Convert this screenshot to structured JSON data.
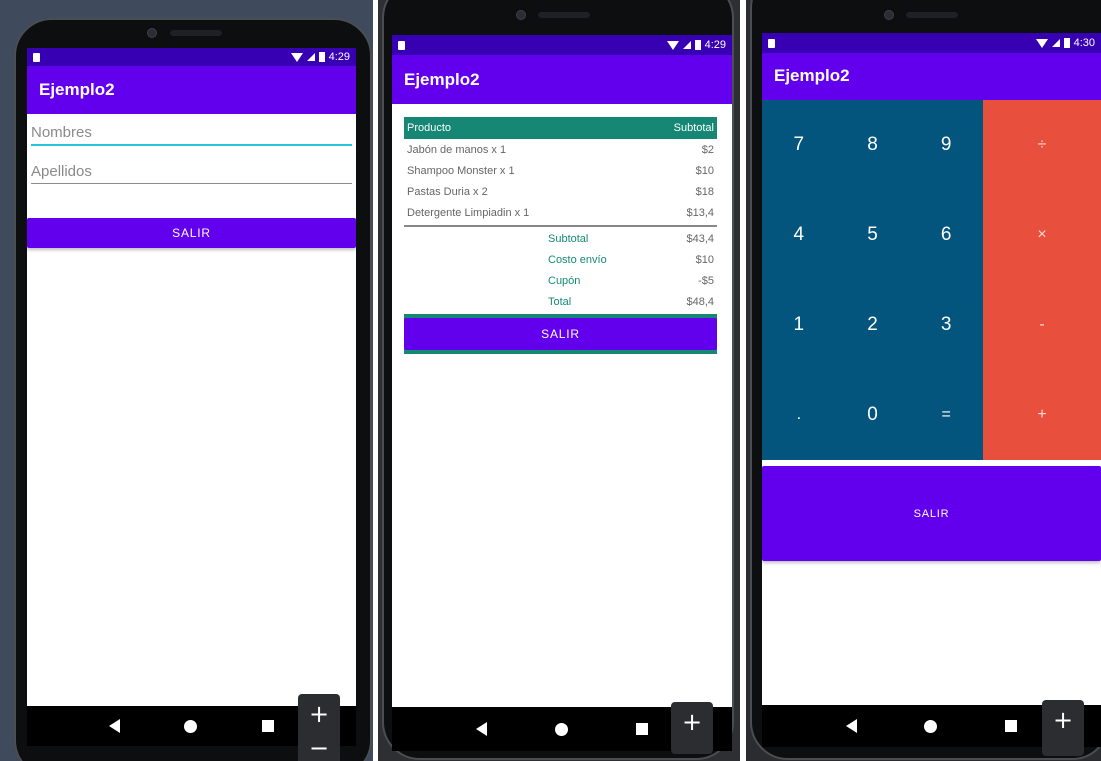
{
  "status": {
    "time1": "4:29",
    "time2": "4:29",
    "time3": "4:30"
  },
  "app": {
    "title": "Ejemplo2"
  },
  "screen1": {
    "nombres_placeholder": "Nombres",
    "apellidos_placeholder": "Apellidos",
    "salir": "SALIR"
  },
  "screen2": {
    "header": {
      "producto": "Producto",
      "subtotal": "Subtotal"
    },
    "items": [
      {
        "name": "Jabón de manos x 1",
        "price": "$2"
      },
      {
        "name": "Shampoo Monster x 1",
        "price": "$10"
      },
      {
        "name": "Pastas Duria x 2",
        "price": "$18"
      },
      {
        "name": "Detergente Limpiadin x 1",
        "price": "$13,4"
      }
    ],
    "summary": [
      {
        "label": "Subtotal",
        "value": "$43,4"
      },
      {
        "label": "Costo envío",
        "value": "$10"
      },
      {
        "label": "Cupón",
        "value": "-$5"
      },
      {
        "label": "Total",
        "value": "$48,4"
      }
    ],
    "salir": "SALIR"
  },
  "screen3": {
    "numbers": [
      "7",
      "8",
      "9",
      "4",
      "5",
      "6",
      "1",
      "2",
      "3",
      ".",
      "0",
      "="
    ],
    "operators": [
      "÷",
      "×",
      "-",
      "+"
    ],
    "salir": "SALIR"
  },
  "zoom": {
    "plus": "+",
    "minus": "−"
  },
  "colors": {
    "status_bar": "#3700b3",
    "app_bar": "#6200ee",
    "teal": "#158774",
    "calc_blue": "#03557d",
    "calc_red": "#e94f3d"
  }
}
